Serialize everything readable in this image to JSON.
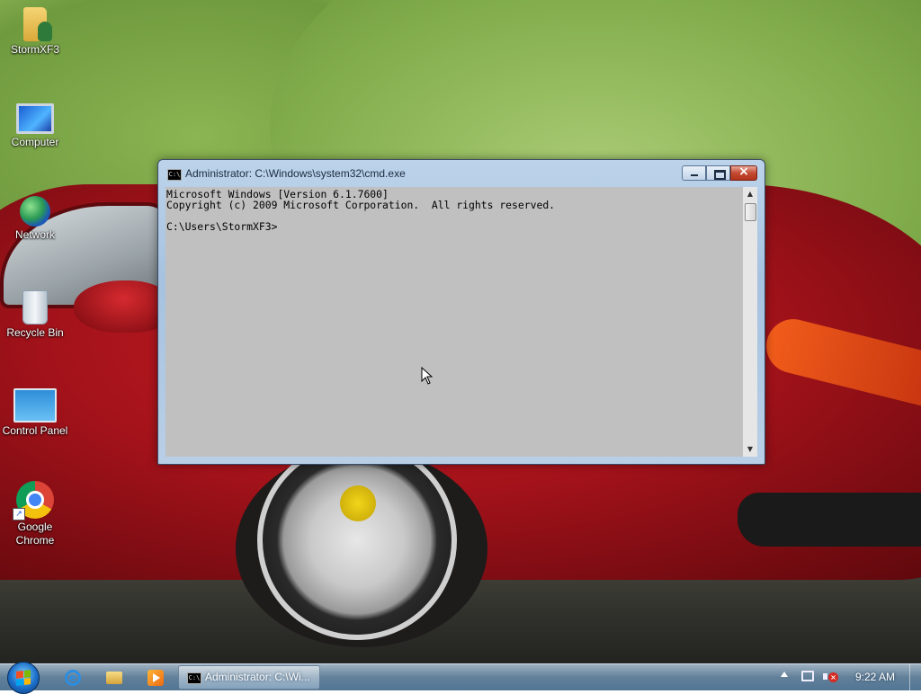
{
  "desktop": {
    "icons": [
      {
        "label": "StormXF3",
        "icon": "user-folder-icon"
      },
      {
        "label": "Computer",
        "icon": "computer-icon"
      },
      {
        "label": "Network",
        "icon": "network-icon"
      },
      {
        "label": "Recycle Bin",
        "icon": "recycle-bin-icon"
      },
      {
        "label": "Control Panel",
        "icon": "control-panel-icon"
      },
      {
        "label": "Google\nChrome",
        "icon": "chrome-icon"
      }
    ]
  },
  "cmd_window": {
    "title": "Administrator: C:\\Windows\\system32\\cmd.exe",
    "icon_text": "C:\\",
    "console_text": "Microsoft Windows [Version 6.1.7600]\nCopyright (c) 2009 Microsoft Corporation.  All rights reserved.\n\nC:\\Users\\StormXF3>",
    "buttons": {
      "minimize": "minimize",
      "maximize": "maximize",
      "close": "×"
    },
    "colors": {
      "console_bg": "#c0c0c0",
      "console_fg": "#000000"
    }
  },
  "taskbar": {
    "pinned": [
      {
        "name": "Internet Explorer",
        "icon": "ie-icon"
      },
      {
        "name": "Windows Explorer",
        "icon": "folder-icon"
      },
      {
        "name": "Windows Media Player",
        "icon": "media-player-icon"
      }
    ],
    "active_task": "Administrator: C:\\Wi...",
    "task_icon_text": "C:\\",
    "clock": "9:22 AM",
    "tray": [
      "show-hidden-icons",
      "network-icon",
      "volume-muted-icon"
    ]
  }
}
